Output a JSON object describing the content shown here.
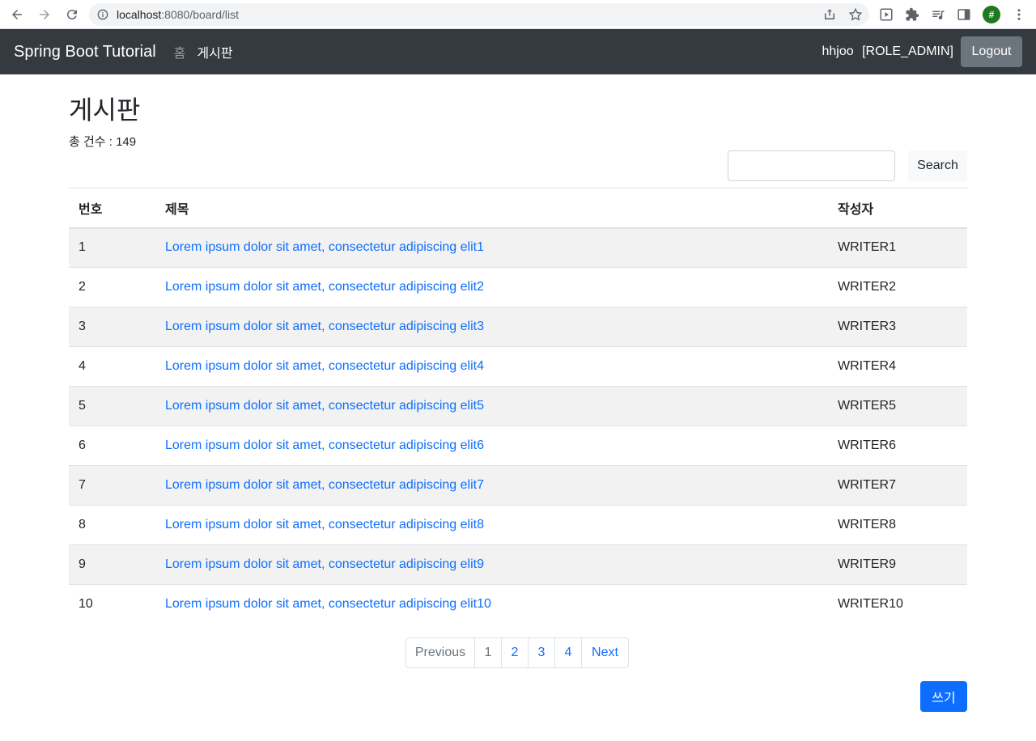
{
  "browser": {
    "url_host": "localhost",
    "url_path": ":8080/board/list",
    "profile_initial": "#"
  },
  "navbar": {
    "brand": "Spring Boot Tutorial",
    "links": [
      {
        "label": "홈",
        "active": false
      },
      {
        "label": "게시판",
        "active": true
      }
    ],
    "username": "hhjoo",
    "role": "[ROLE_ADMIN]",
    "logout_label": "Logout",
    "bg_color": "#343a40"
  },
  "page": {
    "title": "게시판",
    "total_label": "총 건수 : 149"
  },
  "search": {
    "value": "",
    "button_label": "Search"
  },
  "table": {
    "headers": [
      "번호",
      "제목",
      "작성자"
    ],
    "rows": [
      {
        "num": "1",
        "title": "Lorem ipsum dolor sit amet, consectetur adipiscing elit1",
        "writer": "WRITER1"
      },
      {
        "num": "2",
        "title": "Lorem ipsum dolor sit amet, consectetur adipiscing elit2",
        "writer": "WRITER2"
      },
      {
        "num": "3",
        "title": "Lorem ipsum dolor sit amet, consectetur adipiscing elit3",
        "writer": "WRITER3"
      },
      {
        "num": "4",
        "title": "Lorem ipsum dolor sit amet, consectetur adipiscing elit4",
        "writer": "WRITER4"
      },
      {
        "num": "5",
        "title": "Lorem ipsum dolor sit amet, consectetur adipiscing elit5",
        "writer": "WRITER5"
      },
      {
        "num": "6",
        "title": "Lorem ipsum dolor sit amet, consectetur adipiscing elit6",
        "writer": "WRITER6"
      },
      {
        "num": "7",
        "title": "Lorem ipsum dolor sit amet, consectetur adipiscing elit7",
        "writer": "WRITER7"
      },
      {
        "num": "8",
        "title": "Lorem ipsum dolor sit amet, consectetur adipiscing elit8",
        "writer": "WRITER8"
      },
      {
        "num": "9",
        "title": "Lorem ipsum dolor sit amet, consectetur adipiscing elit9",
        "writer": "WRITER9"
      },
      {
        "num": "10",
        "title": "Lorem ipsum dolor sit amet, consectetur adipiscing elit10",
        "writer": "WRITER10"
      }
    ]
  },
  "pagination": {
    "previous": "Previous",
    "pages": [
      "1",
      "2",
      "3",
      "4"
    ],
    "current": "1",
    "next": "Next"
  },
  "write_button_label": "쓰기",
  "colors": {
    "link": "#0d6efd",
    "primary": "#0d6efd",
    "secondary": "#6c757d"
  }
}
